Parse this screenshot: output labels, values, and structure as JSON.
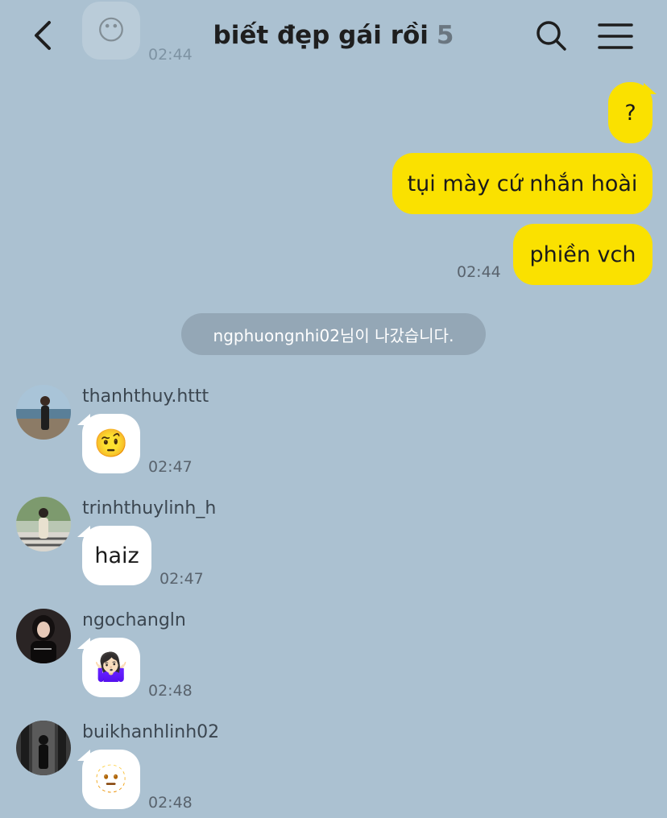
{
  "header": {
    "title": "biết đẹp gái rồi",
    "member_count": "5",
    "ghost_time": "02:44",
    "ghost_emoji": "😶"
  },
  "sent_messages": [
    {
      "text": "?"
    },
    {
      "text": "tụi mày cứ nhắn hoài"
    },
    {
      "text": "phiền vch",
      "time": "02:44"
    }
  ],
  "system_notice": "ngphuongnhi02님이 나갔습니다.",
  "received_messages": [
    {
      "sender": "thanhthuy.httt",
      "content": "🤨",
      "time": "02:47"
    },
    {
      "sender": "trinhthuylinh_h",
      "content": "haiz",
      "time": "02:47"
    },
    {
      "sender": "ngochangln",
      "content": "🤷🏻‍♀️",
      "time": "02:48"
    },
    {
      "sender": "buikhanhlinh02",
      "content": "🫥",
      "time": "02:48"
    }
  ],
  "colors": {
    "background": "#abc1d1",
    "sent_bubble": "#fae100",
    "received_bubble": "#ffffff",
    "notice_bg": "#94a7b6"
  },
  "icons": [
    "back-chevron-icon",
    "search-icon",
    "menu-icon"
  ]
}
